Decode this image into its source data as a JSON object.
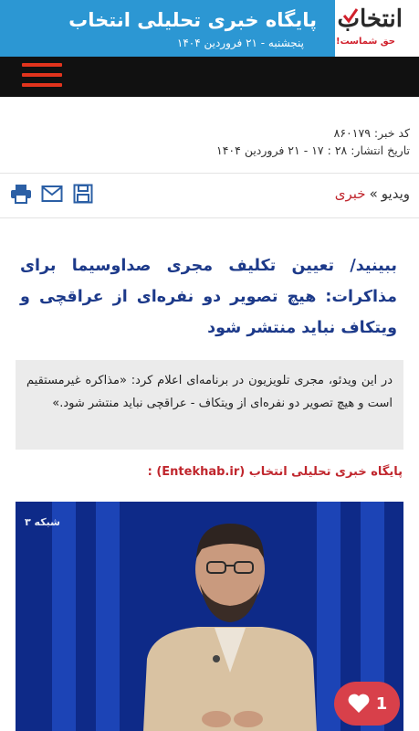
{
  "header": {
    "logo_word": "انتخاب",
    "logo_tagline": "حق شماست!",
    "site_title": "پایگاه خبری تحلیلی انتخاب",
    "date": "پنجشنبه - ۲۱ فروردین ۱۴۰۴"
  },
  "meta": {
    "code": "کد خبر: ۸۶۰۱۷۹",
    "published": "تاریخ انتشار: ۲۸ : ۱۷ - ۲۱ فروردین ۱۴۰۴"
  },
  "breadcrumb": {
    "section": "ویدیو",
    "separator": "»",
    "category": "خبری"
  },
  "tools": [
    "print-icon",
    "mail-icon",
    "save-icon"
  ],
  "article": {
    "headline": "ببینید/ تعیین تکلیف مجری صداوسیما برای مذاکرات: هیچ تصویر دو نفره‌ای از عراقچی و ویتکاف نباید منتشر شود",
    "lead": "در این ویدئو، مجری تلویزیون در برنامه‌ای اعلام کرد: «مذاکره غیرمستقیم است و هیچ تصویر دو نفره‌ای از ویتکاف - عراقچی نباید منتشر شود.»",
    "source": "پایگاه خبری تحلیلی انتخاب (Entekhab.ir) :"
  },
  "video": {
    "channel_logo": "۳ شبکه",
    "likes": "1"
  },
  "colors": {
    "header_blue": "#2c97d3",
    "nav_black": "#111111",
    "menu_red": "#e2341d",
    "headline_blue": "#1d3a8a",
    "accent_red": "#c0262d",
    "lead_bg": "#ebebeb"
  }
}
